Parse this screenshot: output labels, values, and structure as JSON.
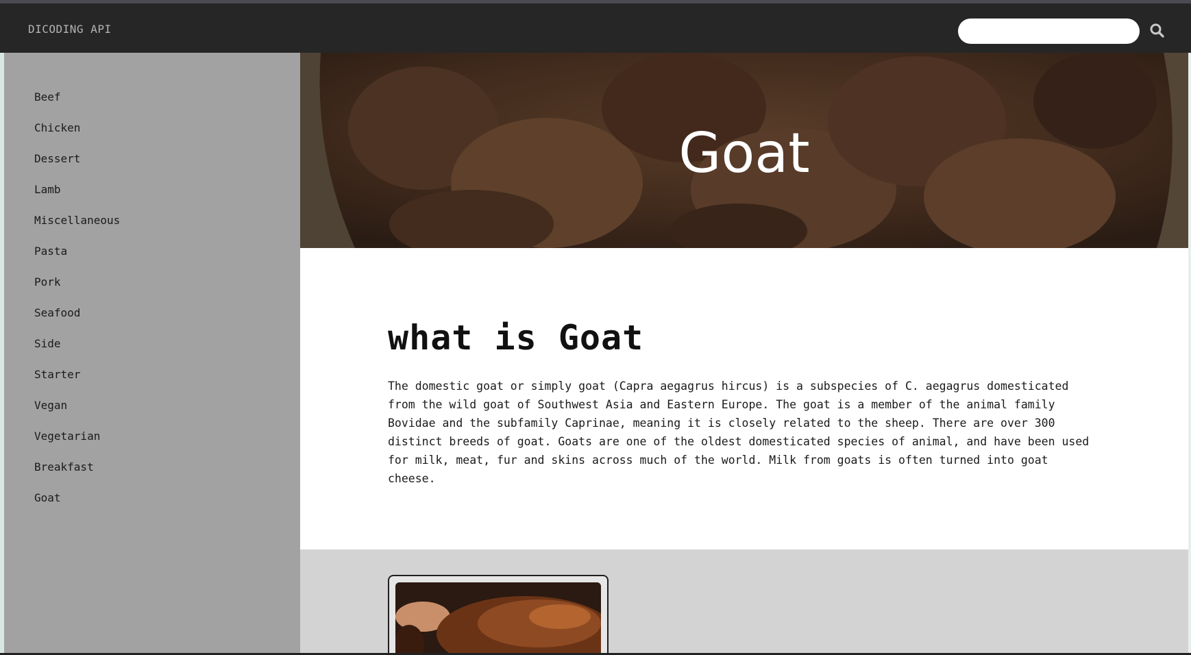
{
  "nav": {
    "brand": "DICODING API",
    "search": {
      "placeholder": "",
      "value": ""
    }
  },
  "sidebar": {
    "items": [
      {
        "label": "Beef"
      },
      {
        "label": "Chicken"
      },
      {
        "label": "Dessert"
      },
      {
        "label": "Lamb"
      },
      {
        "label": "Miscellaneous"
      },
      {
        "label": "Pasta"
      },
      {
        "label": "Pork"
      },
      {
        "label": "Seafood"
      },
      {
        "label": "Side"
      },
      {
        "label": "Starter"
      },
      {
        "label": "Vegan"
      },
      {
        "label": "Vegetarian"
      },
      {
        "label": "Breakfast"
      },
      {
        "label": "Goat"
      }
    ]
  },
  "hero": {
    "title": "Goat"
  },
  "content": {
    "heading_prefix": "what is ",
    "heading_category": "Goat",
    "description": "The domestic goat or simply goat (Capra aegagrus hircus) is a subspecies of C. aegagrus domesticated from the wild goat of Southwest Asia and Eastern Europe. The goat is a member of the animal family Bovidae and the subfamily Caprinae, meaning it is closely related to the sheep. There are over 300 distinct breeds of goat. Goats are one of the oldest domesticated species of animal, and have been used for milk, meat, fur and skins across much of the world. Milk from goats is often turned into goat cheese."
  },
  "colors": {
    "topbar": "#262626",
    "sidebar": "#a2a2a2",
    "card_area": "#d3d3d3"
  },
  "icons": {
    "search": "search-icon"
  }
}
